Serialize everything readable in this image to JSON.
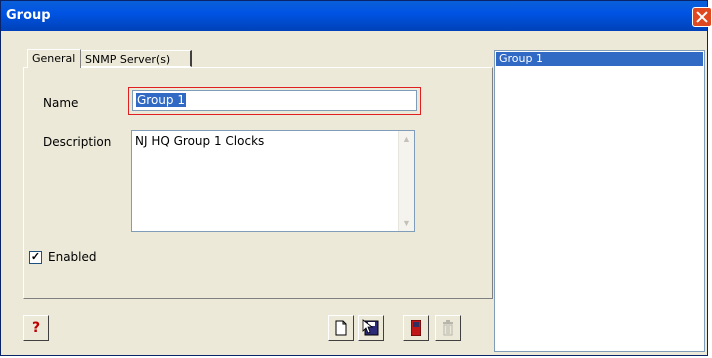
{
  "window": {
    "title": "Group"
  },
  "tabs": [
    {
      "label": "General"
    },
    {
      "label": "SNMP Server(s)"
    }
  ],
  "form": {
    "name_label": "Name",
    "name_value": "Group 1",
    "description_label": "Description",
    "description_value": "NJ HQ Group 1 Clocks",
    "enabled_label": "Enabled",
    "enabled_checked": true,
    "enabled_mark": "✓"
  },
  "toolbar": {
    "help_icon_text": "?",
    "new_icon": "new-document-icon",
    "save_icon": "save-icon",
    "exit_icon": "exit-door-icon",
    "delete_icon": "trash-icon"
  },
  "list": {
    "items": [
      {
        "label": "Group 1",
        "selected": true
      }
    ]
  }
}
